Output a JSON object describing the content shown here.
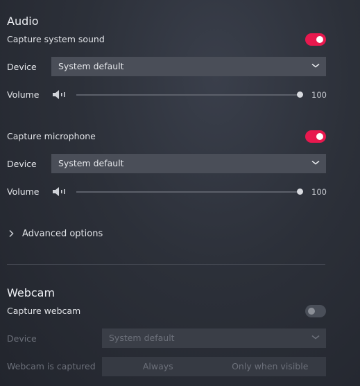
{
  "audio": {
    "title": "Audio",
    "system": {
      "label": "Capture system sound",
      "enabled": true,
      "device_label": "Device",
      "device_value": "System default",
      "volume_label": "Volume",
      "volume_value": "100",
      "volume_fraction": 1.0
    },
    "mic": {
      "label": "Capture microphone",
      "enabled": true,
      "device_label": "Device",
      "device_value": "System default",
      "volume_label": "Volume",
      "volume_value": "100",
      "volume_fraction": 1.0
    },
    "advanced_label": "Advanced options"
  },
  "webcam": {
    "title": "Webcam",
    "capture_label": "Capture webcam",
    "enabled": false,
    "device_label": "Device",
    "device_value": "System default",
    "captured_label": "Webcam is captured",
    "options": [
      "Always",
      "Only when visible"
    ]
  },
  "colors": {
    "accent": "#e8184e",
    "panel_bg": "#2c3039",
    "field_bg": "#4a4e58"
  },
  "icons": [
    "speaker-icon",
    "chevron-down-icon",
    "chevron-right-icon"
  ]
}
